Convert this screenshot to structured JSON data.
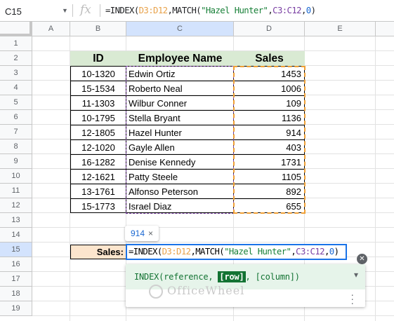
{
  "formula_bar": {
    "name_box": "C15",
    "fx_label": "fx",
    "formula_parts": [
      "=INDEX(",
      "D3:D12",
      ",MATCH(",
      "\"Hazel Hunter\"",
      ",",
      "C3:C12",
      ",",
      "0",
      ")"
    ]
  },
  "columns": [
    "A",
    "B",
    "C",
    "D",
    "E"
  ],
  "rows": [
    "1",
    "2",
    "3",
    "4",
    "5",
    "6",
    "7",
    "8",
    "9",
    "10",
    "11",
    "12",
    "13",
    "14",
    "15",
    "16",
    "17",
    "18",
    "19"
  ],
  "table": {
    "headers": [
      "ID",
      "Employee Name",
      "Sales"
    ],
    "rows": [
      {
        "id": "10-1320",
        "name": "Edwin Ortiz",
        "sales": "1453"
      },
      {
        "id": "15-1534",
        "name": "Roberto Neal",
        "sales": "1006"
      },
      {
        "id": "11-1303",
        "name": "Wilbur Conner",
        "sales": "109"
      },
      {
        "id": "10-1795",
        "name": "Stella Bryant",
        "sales": "1136"
      },
      {
        "id": "12-1805",
        "name": "Hazel Hunter",
        "sales": "914"
      },
      {
        "id": "12-1020",
        "name": "Gayle Allen",
        "sales": "403"
      },
      {
        "id": "16-1282",
        "name": "Denise Kennedy",
        "sales": "1731"
      },
      {
        "id": "12-1621",
        "name": "Patty Steele",
        "sales": "1105"
      },
      {
        "id": "13-1761",
        "name": "Alfonso Peterson",
        "sales": "892"
      },
      {
        "id": "15-1773",
        "name": "Israel Diaz",
        "sales": "655"
      }
    ]
  },
  "sales_label": "Sales:",
  "preview_value": "914",
  "preview_close": "×",
  "help": {
    "sig_prefix": "INDEX(reference, ",
    "sig_highlight": "[row]",
    "sig_suffix": ", [column])"
  },
  "watermark": "OfficeWheel",
  "colors": {
    "header_fill": "#d9ead3",
    "label_fill": "#fce5cd",
    "ref_d": "#e8a24a",
    "ref_c": "#7a3fa3",
    "selection": "#1a73e8"
  }
}
